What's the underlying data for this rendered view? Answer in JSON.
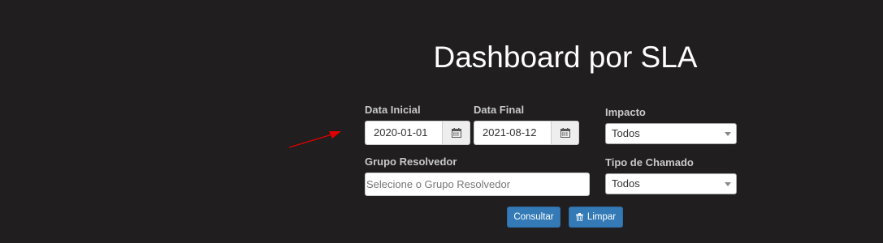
{
  "page": {
    "title": "Dashboard por SLA"
  },
  "filters": {
    "data_inicial": {
      "label": "Data Inicial",
      "value": "2020-01-01",
      "icon": "calendar-icon"
    },
    "data_final": {
      "label": "Data Final",
      "value": "2021-08-12",
      "icon": "calendar-icon"
    },
    "impacto": {
      "label": "Impacto",
      "value": "Todos"
    },
    "grupo_resolvedor": {
      "label": "Grupo Resolvedor",
      "placeholder": "Selecione o Grupo Resolvedor"
    },
    "tipo_chamado": {
      "label": "Tipo de Chamado",
      "value": "Todos"
    }
  },
  "actions": {
    "consultar_label": "Consultar",
    "limpar_label": "Limpar",
    "limpar_icon": "trash-icon"
  },
  "colors": {
    "background": "#201e1f",
    "primary_button": "#337ab7",
    "annotation_arrow": "#e00000"
  }
}
